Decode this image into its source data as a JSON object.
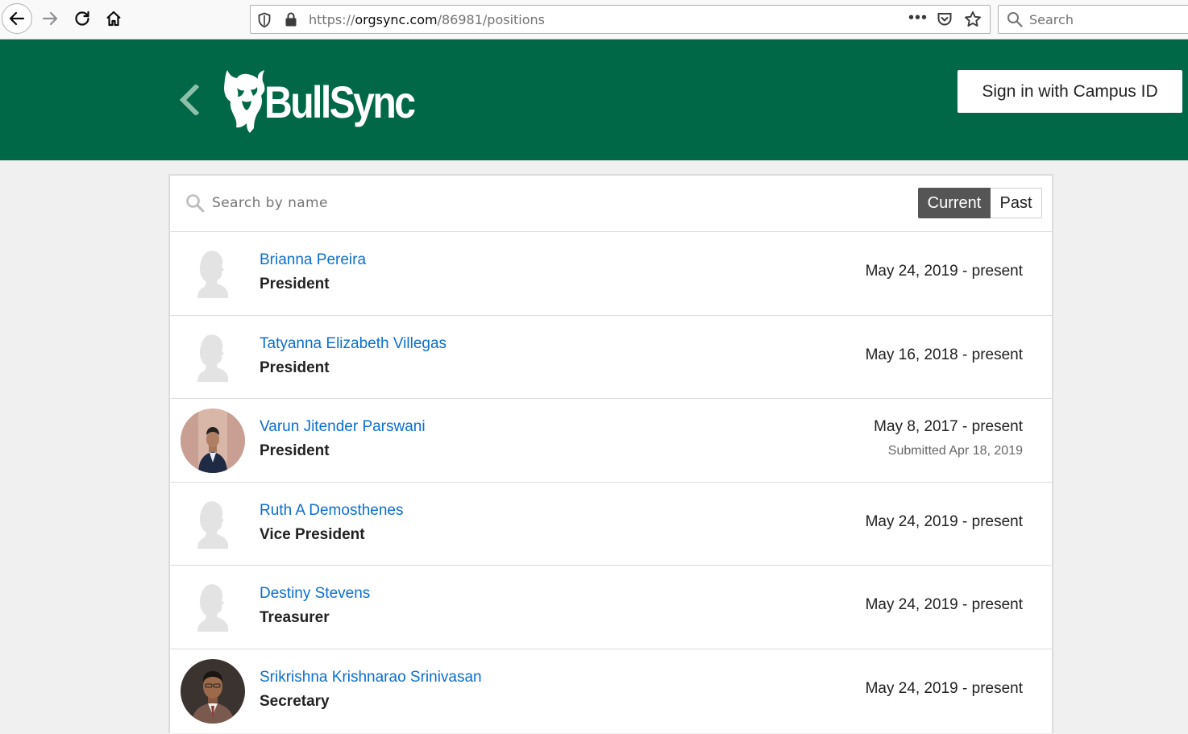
{
  "browser": {
    "url_prefix": "https://",
    "url_host": "orgsync.com",
    "url_path": "/86981/positions",
    "more_label": "•••",
    "search_placeholder": "Search"
  },
  "header": {
    "brand": "BullSync",
    "signin_label": "Sign in with Campus ID",
    "background_color": "#006747"
  },
  "roster": {
    "search_placeholder": "Search by name",
    "filters": [
      {
        "label": "Current",
        "selected": true
      },
      {
        "label": "Past",
        "selected": false
      }
    ],
    "members": [
      {
        "name": "Brianna Pereira",
        "role": "President",
        "dates": "May 24, 2019 - present",
        "note": "",
        "avatar": "silhouette"
      },
      {
        "name": "Tatyanna Elizabeth Villegas",
        "role": "President",
        "dates": "May 16, 2018 - present",
        "note": "",
        "avatar": "silhouette"
      },
      {
        "name": "Varun Jitender Parswani",
        "role": "President",
        "dates": "May 8, 2017 - present",
        "note": "Submitted Apr 18, 2019",
        "avatar": "photo"
      },
      {
        "name": "Ruth A Demosthenes",
        "role": "Vice President",
        "dates": "May 24, 2019 - present",
        "note": "",
        "avatar": "silhouette"
      },
      {
        "name": "Destiny Stevens",
        "role": "Treasurer",
        "dates": "May 24, 2019 - present",
        "note": "",
        "avatar": "silhouette"
      },
      {
        "name": "Srikrishna Krishnarao Srinivasan",
        "role": "Secretary",
        "dates": "May 24, 2019 - present",
        "note": "",
        "avatar": "photo"
      }
    ]
  },
  "colors": {
    "link": "#0a6fd1",
    "toggle_selected": "#555555"
  }
}
